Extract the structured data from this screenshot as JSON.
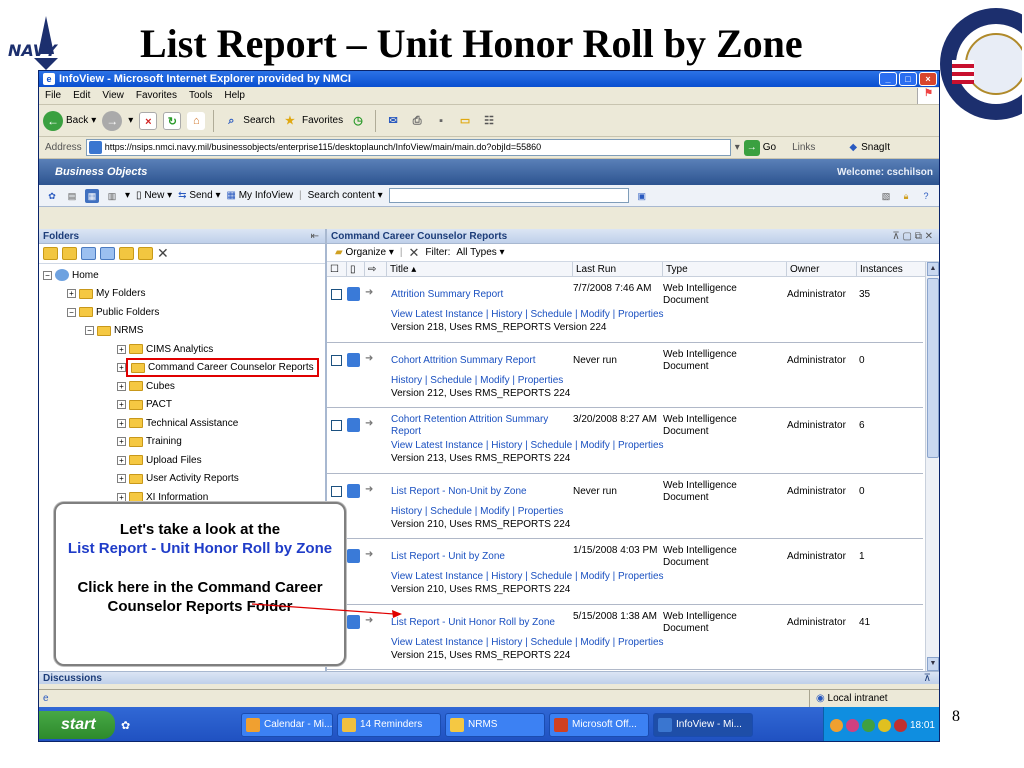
{
  "slide": {
    "title": "List Report – Unit Honor Roll by Zone",
    "logo_text": "NAVY",
    "page_number": "8"
  },
  "browser": {
    "title": "InfoView - Microsoft Internet Explorer provided by NMCI",
    "menu": [
      "File",
      "Edit",
      "View",
      "Favorites",
      "Tools",
      "Help"
    ],
    "toolbar": {
      "back": "Back",
      "search": "Search",
      "favorites": "Favorites"
    },
    "address_label": "Address",
    "address_url": "https://nsips.nmci.navy.mil/businessobjects/enterprise115/desktoplaunch/InfoView/main/main.do?objId=55860",
    "go": "Go",
    "links": "Links",
    "snagit": "SnagIt"
  },
  "bo": {
    "logo": "Business Objects",
    "welcome": "Welcome: cschilson",
    "new": "New",
    "send": "Send",
    "my_infoview": "My InfoView",
    "search_content": "Search content"
  },
  "folders": {
    "header": "Folders",
    "tree": [
      {
        "label": "Home",
        "level": 0,
        "toggle": "−"
      },
      {
        "label": "My Folders",
        "level": 1,
        "toggle": "+"
      },
      {
        "label": "Public Folders",
        "level": 1,
        "toggle": "−"
      },
      {
        "label": "NRMS",
        "level": 2,
        "toggle": "−"
      },
      {
        "label": "CIMS Analytics",
        "level": 3,
        "toggle": "+"
      },
      {
        "label": "Command Career Counselor Reports",
        "level": 3,
        "toggle": "+"
      },
      {
        "label": "Cubes",
        "level": 3,
        "toggle": "+"
      },
      {
        "label": "PACT",
        "level": 3,
        "toggle": "+"
      },
      {
        "label": "Technical Assistance",
        "level": 3,
        "toggle": "+"
      },
      {
        "label": "Training",
        "level": 3,
        "toggle": "+"
      },
      {
        "label": "Upload Files",
        "level": 3,
        "toggle": "+"
      },
      {
        "label": "User Activity Reports",
        "level": 3,
        "toggle": "+"
      },
      {
        "label": "XI Information",
        "level": 3,
        "toggle": "+"
      }
    ]
  },
  "reports": {
    "header": "Command Career Counselor Reports",
    "organize": "Organize",
    "filter_label": "Filter:",
    "filter_value": "All Types",
    "columns": {
      "title": "Title",
      "last_run": "Last Run",
      "type": "Type",
      "owner": "Owner",
      "instances": "Instances"
    },
    "rows": [
      {
        "title": "Attrition Summary Report",
        "last_run": "7/7/2008 7:46 AM",
        "type": "Web Intelligence Document",
        "owner": "Administrator",
        "instances": "35",
        "links": "View Latest Instance | History | Schedule | Modify | Properties",
        "version": "Version 218, Uses RMS_REPORTS Version 224"
      },
      {
        "title": "Cohort Attrition Summary Report",
        "last_run": "Never run",
        "type": "Web Intelligence Document",
        "owner": "Administrator",
        "instances": "0",
        "links": "History | Schedule | Modify | Properties",
        "version": "Version 212, Uses RMS_REPORTS 224"
      },
      {
        "title": "Cohort Retention Attrition Summary Report",
        "last_run": "3/20/2008 8:27 AM",
        "type": "Web Intelligence Document",
        "owner": "Administrator",
        "instances": "6",
        "links": "View Latest Instance | History | Schedule | Modify | Properties",
        "version": "Version 213, Uses RMS_REPORTS 224"
      },
      {
        "title": "List Report - Non-Unit by Zone",
        "last_run": "Never run",
        "type": "Web Intelligence Document",
        "owner": "Administrator",
        "instances": "0",
        "links": "History | Schedule | Modify | Properties",
        "version": "Version 210, Uses RMS_REPORTS 224"
      },
      {
        "title": "List Report - Unit by Zone",
        "last_run": "1/15/2008 4:03 PM",
        "type": "Web Intelligence Document",
        "owner": "Administrator",
        "instances": "1",
        "links": "View Latest Instance | History | Schedule | Modify | Properties",
        "version": "Version 210, Uses RMS_REPORTS 224"
      },
      {
        "title": "List Report - Unit Honor Roll by Zone",
        "last_run": "5/15/2008 1:38 AM",
        "type": "Web Intelligence Document",
        "owner": "Administrator",
        "instances": "41",
        "links": "View Latest Instance | History | Schedule | Modify | Properties",
        "version": "Version 215, Uses RMS_REPORTS 224"
      }
    ]
  },
  "discussions": "Discussions",
  "status": {
    "zone": "Local intranet"
  },
  "taskbar": {
    "start": "start",
    "tasks": [
      "Calendar - Mi...",
      "14 Reminders",
      "NRMS",
      "Microsoft Off...",
      "InfoView - Mi..."
    ],
    "clock": "18:01"
  },
  "callout": {
    "line1": "Let's take a look at the",
    "line2": "List Report - Unit Honor Roll by Zone",
    "line3": "Click here in the Command Career Counselor Reports Folder"
  }
}
